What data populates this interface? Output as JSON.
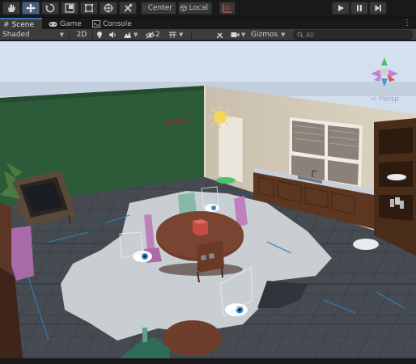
{
  "toolbar": {
    "tools": [
      {
        "name": "hand-tool",
        "icon": "hand-icon",
        "active": false
      },
      {
        "name": "move-tool",
        "icon": "move-icon",
        "active": true
      },
      {
        "name": "rotate-tool",
        "icon": "rotate-icon",
        "active": false
      },
      {
        "name": "scale-tool",
        "icon": "scale-icon",
        "active": false
      },
      {
        "name": "rect-tool",
        "icon": "rect-icon",
        "active": false
      },
      {
        "name": "transform-tool",
        "icon": "transform-icon",
        "active": false
      },
      {
        "name": "custom-tool",
        "icon": "tools-icon",
        "active": false
      }
    ],
    "pivot_label": "Center",
    "space_label": "Local",
    "play_icon": "play-icon",
    "pause_icon": "pause-icon",
    "step_icon": "step-icon"
  },
  "tabs": [
    {
      "label": "Scene",
      "icon": "hash-icon",
      "active": true
    },
    {
      "label": "Game",
      "icon": "gamepad-icon",
      "active": false
    },
    {
      "label": "Console",
      "icon": "console-icon",
      "active": false
    }
  ],
  "scenebar": {
    "draw_mode": "Shaded",
    "mode_2d": "2D",
    "hidden_count": "2",
    "gizmos_label": "Gizmos",
    "search_placeholder": "All"
  },
  "viewport": {
    "projection_label": "< Persp",
    "colors": {
      "sky": "#c7d6ea",
      "floor_tile": "#43494f",
      "rug": "#c9cfd2",
      "wall_green": "#2e5c3a",
      "wall_beige": "#cdc4b3",
      "table_wood": "#6e3b2c",
      "cabinet_wood": "#5b3621",
      "chair_teal": "#7fb7a4",
      "chair_pink": "#c07fbe",
      "gizmo_blue": "#2f88c9"
    }
  }
}
